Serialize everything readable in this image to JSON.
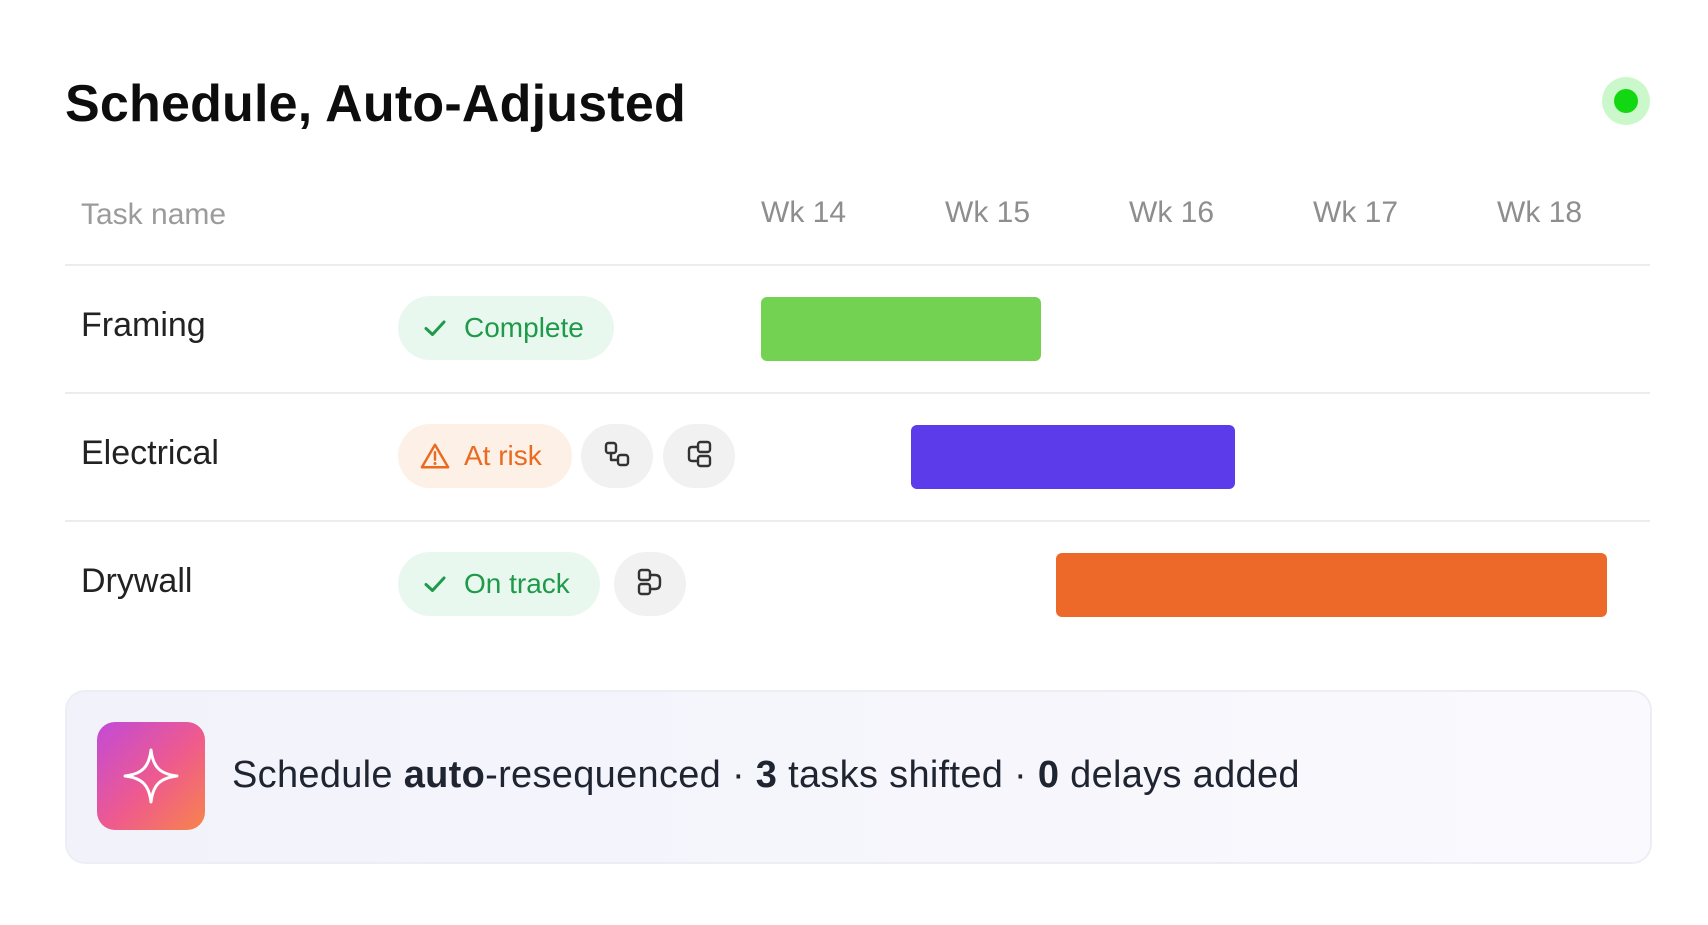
{
  "title": "Schedule, Auto-Adjusted",
  "status_indicator_color": "#12d812",
  "table": {
    "task_column_header": "Task name",
    "weeks": [
      "Wk 14",
      "Wk 15",
      "Wk 16",
      "Wk 17",
      "Wk 18"
    ],
    "rows": [
      {
        "task": "Framing",
        "status": "Complete",
        "status_icon": "check-icon",
        "status_color": "#1f9a4a",
        "bar_color": "#74d253",
        "bar_start_week": 14.0,
        "bar_end_week": 15.5,
        "actions": []
      },
      {
        "task": "Electrical",
        "status": "At risk",
        "status_icon": "warning-triangle-icon",
        "status_color": "#ea6a1f",
        "bar_color": "#5b3bea",
        "bar_start_week": 14.8,
        "bar_end_week": 16.55,
        "actions": [
          "link-dependency-icon",
          "branch-dependency-icon"
        ]
      },
      {
        "task": "Drywall",
        "status": "On track",
        "status_icon": "check-icon",
        "status_color": "#1f9a4a",
        "bar_color": "#ed692a",
        "bar_start_week": 15.6,
        "bar_end_week": 18.6,
        "actions": [
          "merge-dependency-icon"
        ]
      }
    ]
  },
  "banner": {
    "icon": "sparkle-icon",
    "text_part1": "Schedule ",
    "text_bold1": "auto",
    "text_part2": "-resequenced · ",
    "text_bold2": "3",
    "text_part3": " tasks shifted · ",
    "text_bold3": "0",
    "text_part4": " delays added"
  }
}
